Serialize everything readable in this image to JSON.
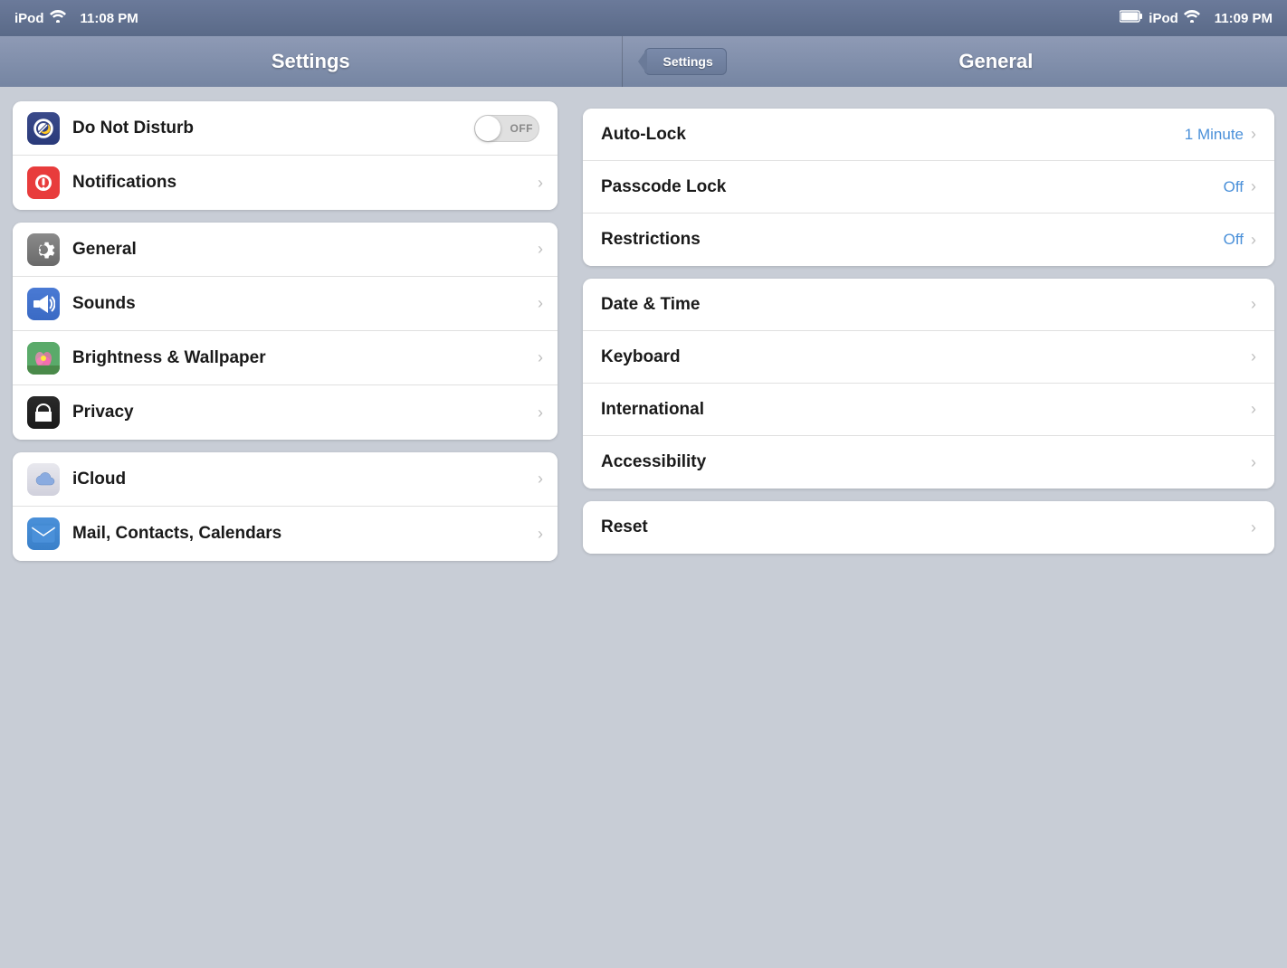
{
  "statusBar": {
    "left": {
      "device": "iPod",
      "time": "11:08 PM"
    },
    "right": {
      "device": "iPod",
      "time": "11:09 PM"
    }
  },
  "navBar": {
    "leftTitle": "Settings",
    "backButton": "Settings",
    "rightTitle": "General"
  },
  "leftPanel": {
    "group1": [
      {
        "id": "do-not-disturb",
        "label": "Do Not Disturb",
        "iconType": "do-not-disturb",
        "toggle": true,
        "toggleState": "OFF"
      },
      {
        "id": "notifications",
        "label": "Notifications",
        "iconType": "notifications",
        "hasChevron": true
      }
    ],
    "group2": [
      {
        "id": "general",
        "label": "General",
        "iconType": "general",
        "hasChevron": true
      },
      {
        "id": "sounds",
        "label": "Sounds",
        "iconType": "sounds",
        "hasChevron": true
      },
      {
        "id": "brightness-wallpaper",
        "label": "Brightness & Wallpaper",
        "iconType": "brightness",
        "hasChevron": true
      },
      {
        "id": "privacy",
        "label": "Privacy",
        "iconType": "privacy",
        "hasChevron": true
      }
    ],
    "group3": [
      {
        "id": "icloud",
        "label": "iCloud",
        "iconType": "icloud",
        "hasChevron": true
      },
      {
        "id": "mail-contacts-calendars",
        "label": "Mail, Contacts, Calendars",
        "iconType": "mail",
        "hasChevron": true
      }
    ]
  },
  "rightPanel": {
    "group1": [
      {
        "id": "auto-lock",
        "label": "Auto-Lock",
        "value": "1 Minute",
        "hasChevron": true
      },
      {
        "id": "passcode-lock",
        "label": "Passcode Lock",
        "value": "Off",
        "hasChevron": true
      },
      {
        "id": "restrictions",
        "label": "Restrictions",
        "value": "Off",
        "hasChevron": true
      }
    ],
    "group2": [
      {
        "id": "date-time",
        "label": "Date & Time",
        "hasChevron": true
      },
      {
        "id": "keyboard",
        "label": "Keyboard",
        "hasChevron": true
      },
      {
        "id": "international",
        "label": "International",
        "hasChevron": true
      },
      {
        "id": "accessibility",
        "label": "Accessibility",
        "hasChevron": true
      }
    ],
    "group3": [
      {
        "id": "reset",
        "label": "Reset",
        "hasChevron": true
      }
    ]
  }
}
